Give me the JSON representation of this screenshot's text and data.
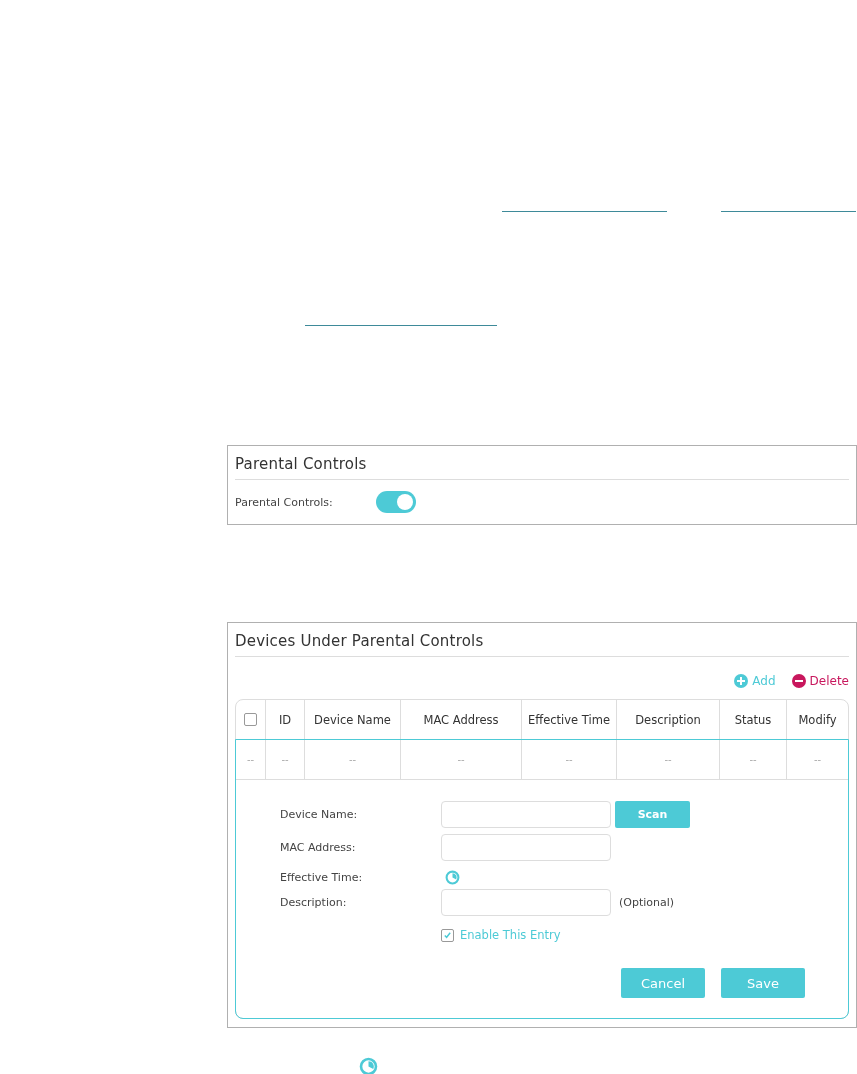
{
  "parental_controls": {
    "title": "Parental Controls",
    "label": "Parental Controls:",
    "on": true
  },
  "devices": {
    "title": "Devices Under Parental Controls",
    "actions": [
      {
        "kind": "add",
        "label": "Add"
      },
      {
        "kind": "delete",
        "label": "Delete"
      }
    ],
    "table": {
      "select_all_checked": false,
      "columns": [
        "",
        "ID",
        "Device Name",
        "MAC Address",
        "Effective Time",
        "Description",
        "Status",
        "Modify"
      ],
      "rows": [
        [
          "--",
          "--",
          "--",
          "--",
          "--",
          "--",
          "--",
          "--"
        ]
      ]
    },
    "form": {
      "fields": [
        {
          "kind": "input",
          "label": "Device Name:",
          "button": "Scan"
        },
        {
          "kind": "input",
          "label": "MAC Address:"
        },
        {
          "kind": "time",
          "label": "Effective Time:"
        },
        {
          "kind": "input",
          "label": "Description:",
          "note": "(Optional)"
        }
      ],
      "enable": {
        "label": "Enable This Entry",
        "checked": true
      },
      "buttons": [
        "Cancel",
        "Save"
      ]
    }
  }
}
